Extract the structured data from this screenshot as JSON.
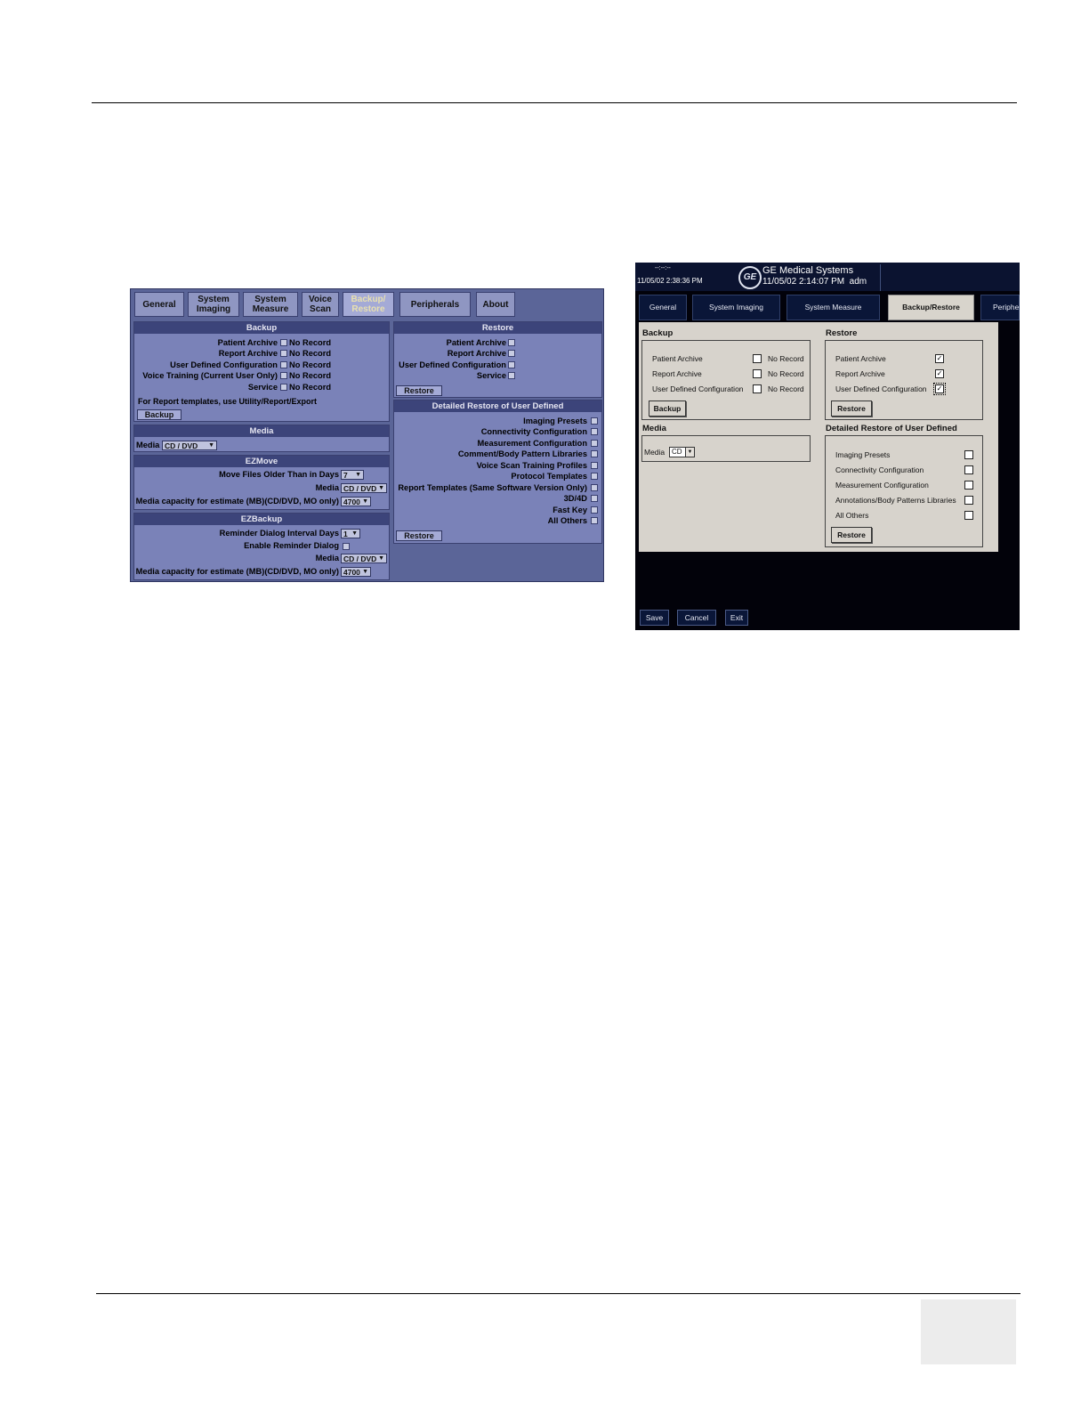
{
  "left_screen": {
    "tabs": [
      "General",
      "System\nImaging",
      "System\nMeasure",
      "Voice\nScan",
      "Backup/\nRestore",
      "Peripherals",
      "About"
    ],
    "active_tab": "Backup/\nRestore",
    "backup": {
      "title": "Backup",
      "items": [
        {
          "label": "Patient Archive",
          "status": "No Record"
        },
        {
          "label": "Report Archive",
          "status": "No Record"
        },
        {
          "label": "User Defined Configuration",
          "status": "No Record"
        },
        {
          "label": "Voice Training (Current User Only)",
          "status": "No Record"
        },
        {
          "label": "Service",
          "status": "No Record"
        }
      ],
      "note": "For Report templates, use Utility/Report/Export",
      "button": "Backup"
    },
    "media": {
      "title": "Media",
      "label": "Media",
      "value": "CD / DVD"
    },
    "ezmove": {
      "title": "EZMove",
      "days_label": "Move Files Older Than in Days",
      "days_value": "7",
      "media_label": "Media",
      "media_value": "CD / DVD",
      "capacity_label": "Media capacity for estimate (MB)(CD/DVD, MO only)",
      "capacity_value": "4700"
    },
    "ezbackup": {
      "title": "EZBackup",
      "interval_label": "Reminder Dialog Interval Days",
      "interval_value": "1",
      "enable_label": "Enable Reminder Dialog",
      "media_label": "Media",
      "media_value": "CD / DVD",
      "capacity_label": "Media capacity for estimate (MB)(CD/DVD, MO only)",
      "capacity_value": "4700"
    },
    "restore": {
      "title": "Restore",
      "items": [
        "Patient Archive",
        "Report Archive",
        "User Defined Configuration",
        "Service"
      ],
      "button": "Restore"
    },
    "detailed": {
      "title": "Detailed Restore of User Defined",
      "items": [
        "Imaging Presets",
        "Connectivity Configuration",
        "Measurement Configuration",
        "Comment/Body Pattern Libraries",
        "Voice Scan Training Profiles",
        "Protocol Templates",
        "Report Templates (Same Software Version Only)",
        "3D/4D",
        "Fast Key",
        "All Others"
      ],
      "button": "Restore"
    }
  },
  "right_screen": {
    "header": {
      "small_time_top": "--:--:--",
      "small_time": "11/05/02 2:38:36 PM",
      "logo": "GE",
      "brand": "GE Medical Systems",
      "datetime": "11/05/02 2:14:07 PM",
      "user": "adm"
    },
    "tabs": [
      "General",
      "System Imaging",
      "System Measure",
      "Backup/Restore",
      "Periphe"
    ],
    "active_tab": "Backup/Restore",
    "backup": {
      "title": "Backup",
      "items": [
        {
          "label": "Patient Archive",
          "status": "No Record"
        },
        {
          "label": "Report Archive",
          "status": "No Record"
        },
        {
          "label": "User Defined Configuration",
          "status": "No Record"
        }
      ],
      "button": "Backup"
    },
    "media": {
      "title": "Media",
      "label": "Media",
      "value": "CD"
    },
    "restore": {
      "title": "Restore",
      "items": [
        {
          "label": "Patient Archive",
          "checked": "✓"
        },
        {
          "label": "Report Archive",
          "checked": "✓"
        },
        {
          "label": "User Defined Configuration",
          "checked": "✓"
        }
      ],
      "button": "Restore"
    },
    "detailed": {
      "title": "Detailed Restore of User Defined",
      "items": [
        "Imaging Presets",
        "Connectivity Configuration",
        "Measurement Configuration",
        "Annotations/Body Patterns Libraries",
        "All Others"
      ],
      "button": "Restore"
    },
    "footer": {
      "save": "Save",
      "cancel": "Cancel",
      "exit": "Exit"
    }
  },
  "colors": {
    "left_bg": "#5b6598",
    "left_header": "#3c447a",
    "right_bg": "#02020a",
    "right_panel": "#d7d3cc"
  }
}
